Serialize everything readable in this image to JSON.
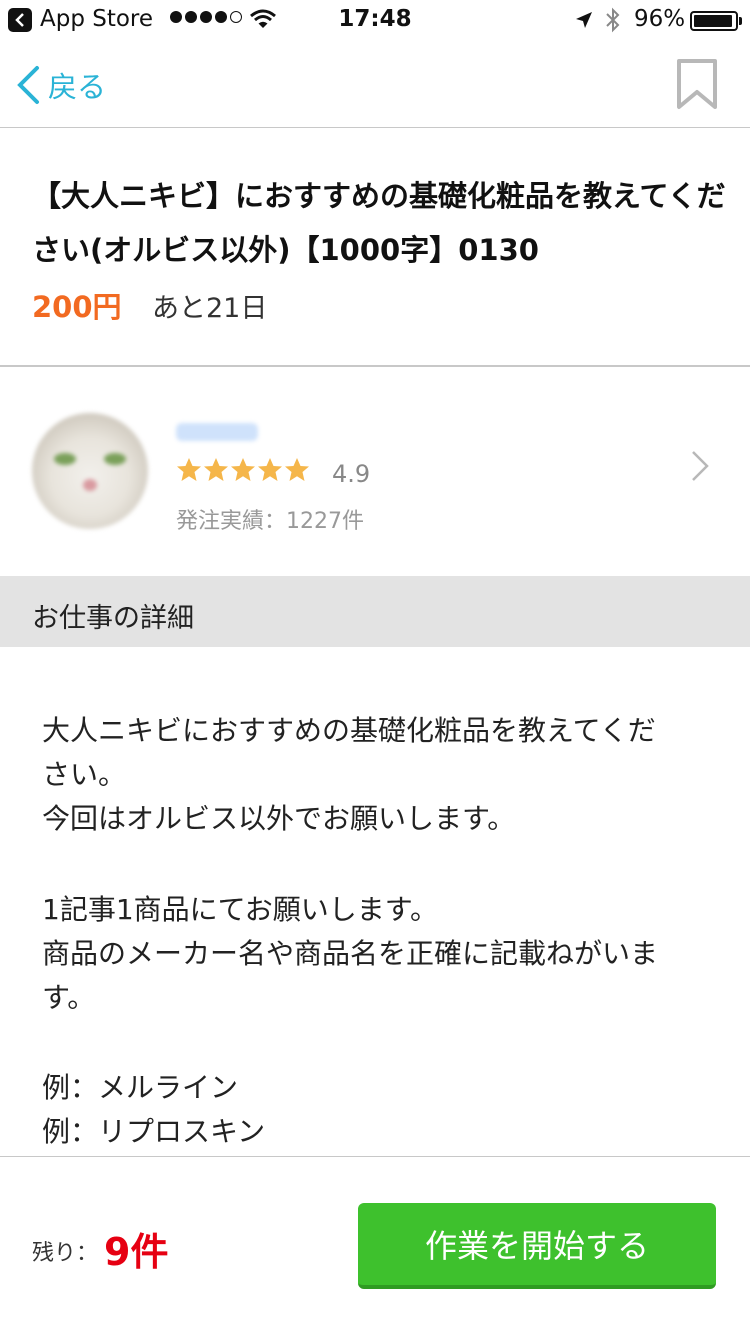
{
  "status_bar": {
    "back_app": "App Store",
    "time": "17:48",
    "battery_percent": "96%",
    "signal_dots_filled": 4,
    "signal_dots_total": 5,
    "battery_level": 0.96
  },
  "nav": {
    "back_label": "戻る",
    "accent_color": "#2ab3d6",
    "bookmark_icon": "bookmark-outline-icon"
  },
  "job": {
    "title": "【大人ニキビ】におすすめの基礎化粧品を教えてください(オルビス以外)【1000字】0130",
    "price": "200円",
    "remaining_days": "あと21日",
    "price_color": "#f26a21"
  },
  "client": {
    "name": "",
    "stars": 5,
    "rating": "4.9",
    "orders_text": "発注実績：1227件",
    "star_color": "#f5b64a"
  },
  "section": {
    "details_header": "お仕事の詳細"
  },
  "details": {
    "lines": [
      "大人ニキビにおすすめの基礎化粧品を教えてくだ",
      "さい。",
      "今回はオルビス以外でお願いします。",
      "",
      "1記事1商品にてお願いします。",
      "商品のメーカー名や商品名を正確に記載ねがいま",
      "す。",
      "",
      "例：メルライン",
      "例：リプロスキン"
    ]
  },
  "bottom": {
    "stock_label": "残り：",
    "stock_value": "9件",
    "start_button": "作業を開始する",
    "button_color": "#3ec12d"
  }
}
